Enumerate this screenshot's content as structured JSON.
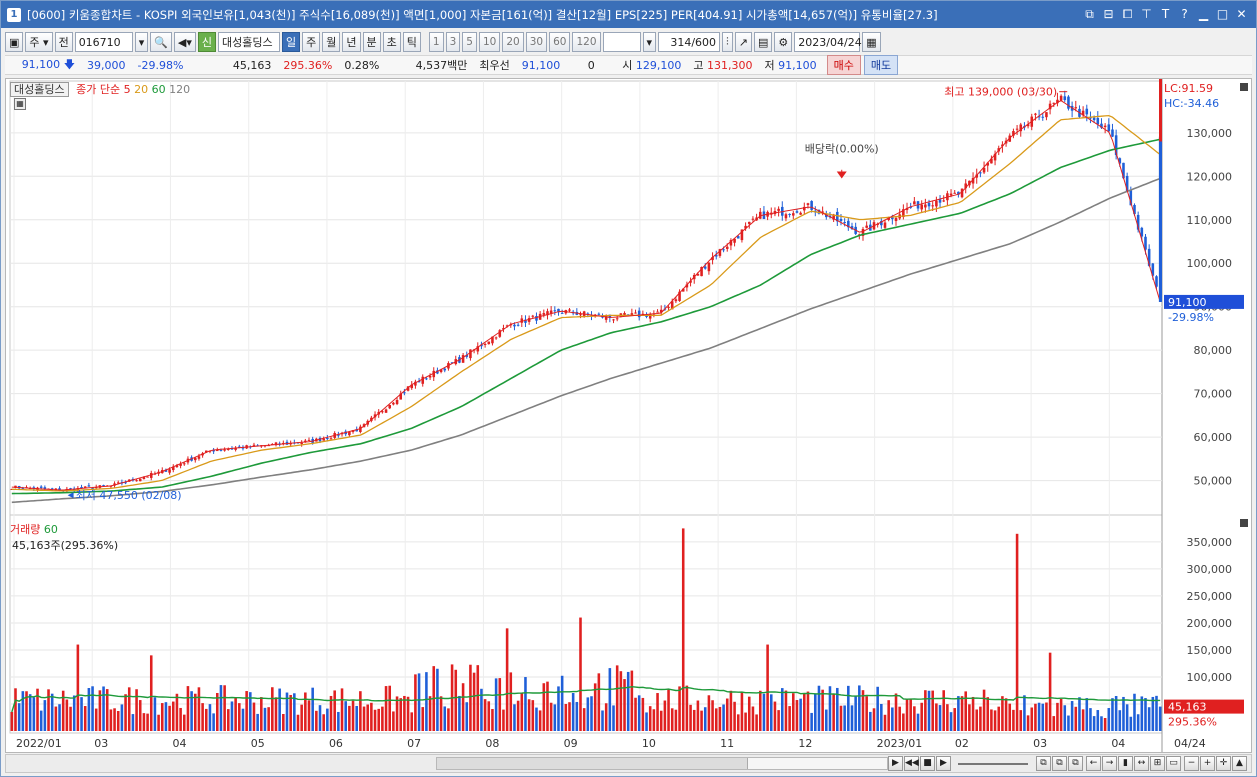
{
  "window": {
    "title": "[0600] 키움종합차트 - KOSPI 외국인보유[1,043(천)] 주식수[16,089(천)] 액면[1,000] 자본금[161(억)] 결산[12월] EPS[225] PER[404.91] 시가총액[14,657(억)] 유통비율[27.3]",
    "app_number": "1"
  },
  "toolbar": {
    "period_sel": "주",
    "prev_label": "전",
    "code": "016710",
    "credit_badge": "신",
    "stock_name": "대성홀딩스",
    "periods": [
      "일",
      "주",
      "월",
      "년",
      "분",
      "초",
      "틱"
    ],
    "active_period": "일",
    "intervals": [
      "1",
      "3",
      "5",
      "10",
      "20",
      "30",
      "60",
      "120"
    ],
    "count": "314",
    "count_total": "/600",
    "date": "2023/04/24"
  },
  "quote": {
    "price": "91,100",
    "change": "39,000",
    "change_pct": "-29.98%",
    "volume": "45,163",
    "volume_ratio": "295.36%",
    "turnover": "0.28%",
    "amount": "4,537백만",
    "best_bid_label": "최우선",
    "best_bid": "91,100",
    "best_bid_qty": "0",
    "open_label": "시",
    "open": "129,100",
    "high_label": "고",
    "high": "131,300",
    "low_label": "저",
    "low": "91,100",
    "buy_label": "매수",
    "sell_label": "매도"
  },
  "price_panel": {
    "stock_tag": "대성홀딩스",
    "legend_prefix": "종가 단순",
    "ma_labels": [
      "5",
      "20",
      "60",
      "120"
    ],
    "lc_label": "LC:91.59",
    "hc_label": "HC:-34.46",
    "high_annotation": "최고 139,000 (03/30)",
    "low_annotation": "최저 47,550 (02/08)",
    "dividend_annotation": "배당락(0.00%)",
    "last_price_tag": "91,100",
    "last_pct_tag": "-29.98%"
  },
  "volume_panel": {
    "legend_title": "거래량",
    "legend_ma": "60",
    "value_label": "45,163주(295.36%)",
    "last_volume_tag": "45,163",
    "last_volume_pct": "295.36%"
  },
  "x_axis": {
    "labels": [
      "2022/01",
      "03",
      "04",
      "05",
      "06",
      "07",
      "08",
      "09",
      "10",
      "11",
      "12",
      "2023/01",
      "02",
      "03",
      "04"
    ],
    "end_label": "04/24"
  },
  "colors": {
    "up": "#e02020",
    "down": "#1f5fd8",
    "ma5": "#e02020",
    "ma20": "#d99a1a",
    "ma60": "#1e9a3a",
    "ma120": "#808080"
  },
  "chart_data": [
    {
      "type": "candlestick",
      "y_axis_ticks": [
        50000,
        60000,
        70000,
        80000,
        90000,
        100000,
        110000,
        120000,
        130000
      ],
      "y_tick_labels": [
        "50,000",
        "60,000",
        "70,000",
        "80,000",
        "90,000",
        "100,000",
        "110,000",
        "120,000",
        "130,000"
      ],
      "ylim": [
        43000,
        141000
      ],
      "x": [
        "2022/01",
        "03",
        "04",
        "05",
        "06",
        "07",
        "08",
        "09",
        "10",
        "11",
        "12",
        "2023/01",
        "02",
        "03",
        "04"
      ],
      "close_path": [
        48500,
        47800,
        48800,
        52000,
        57000,
        58000,
        59000,
        62000,
        72000,
        78000,
        86000,
        89000,
        87500,
        88500,
        101000,
        111000,
        113000,
        107000,
        113000,
        116000,
        129000,
        137500,
        130000,
        91100
      ],
      "ma20_path": [
        48000,
        47600,
        48200,
        50000,
        54500,
        57000,
        58500,
        60500,
        67000,
        75000,
        82500,
        87500,
        88000,
        88000,
        95000,
        106000,
        112000,
        110000,
        111000,
        114000,
        123000,
        133000,
        134000,
        125000
      ],
      "ma60_path": [
        47000,
        47200,
        47600,
        48500,
        51000,
        54000,
        56500,
        58500,
        62000,
        67000,
        73500,
        80000,
        84000,
        86500,
        90000,
        95000,
        102000,
        106500,
        109000,
        111500,
        116000,
        122000,
        126000,
        128500
      ],
      "ma120_path": [
        45000,
        45800,
        46500,
        47500,
        49000,
        50800,
        52500,
        54500,
        57000,
        60500,
        65000,
        69500,
        73500,
        77000,
        80500,
        85000,
        89500,
        93500,
        97500,
        101000,
        104500,
        109500,
        115000,
        119500
      ],
      "high": 139000,
      "low": 47550,
      "last": 91100
    },
    {
      "type": "bar",
      "y_axis_ticks": [
        50000,
        100000,
        150000,
        200000,
        250000,
        300000,
        350000
      ],
      "y_tick_labels": [
        "50,000",
        "100,000",
        "150,000",
        "200,000",
        "250,000",
        "300,000",
        "350,000"
      ],
      "ylim": [
        0,
        385000
      ],
      "spikes": [
        {
          "x": "2022/01",
          "value": 160000
        },
        {
          "x": "03",
          "value": 140000
        },
        {
          "x": "07",
          "value": 190000
        },
        {
          "x": "08",
          "value": 210000
        },
        {
          "x": "09",
          "value": 375000
        },
        {
          "x": "10",
          "value": 160000
        },
        {
          "x": "12",
          "value": 365000
        },
        {
          "x": "03",
          "value": 145000
        }
      ],
      "last": 45163
    }
  ]
}
